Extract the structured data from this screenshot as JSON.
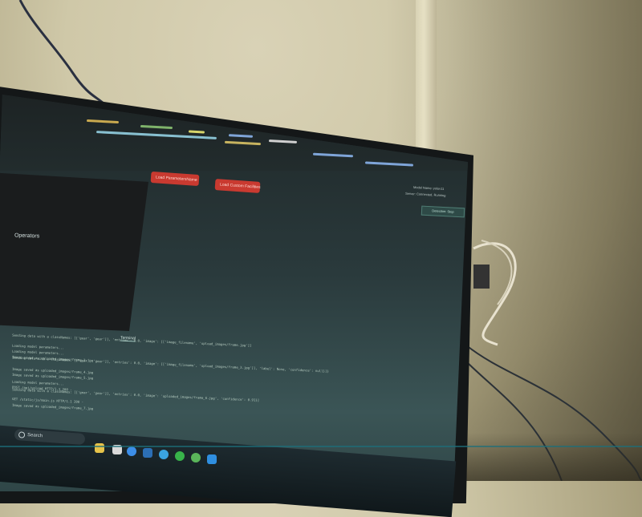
{
  "editor": {
    "button_1": "Load ParametersName",
    "button_2": "Load Custom Facilities",
    "status_line_1": "Model Name: yolov11",
    "status_line_2": "Server: Connected, Running",
    "status_button": "Detection: Stop"
  },
  "panel": {
    "label": "Operators"
  },
  "terminal": {
    "tab": "Terminal",
    "lines": [
      "Sending data with a classNames: [['gear', 'gear']], 'entries': 0.0, 'image': [['image_filename', 'upload_images/frame.jpg']]",
      "Loading model parameters...",
      "Loading model parameters...",
      "Image saved as uploaded_images/frame_2.jpg",
      "Sending data with a classNames: [['gear', 'gear']], 'entries': 0.0, 'image': [['image_filename', 'upload_images/frame_3.jpg']], 'label': None, 'confidence': null}]}",
      "Image saved as uploaded_images/frame_4.jpg",
      "Image saved as uploaded_images/frame_5.jpg",
      "Loading model parameters...",
      "POST /api/upload HTTP/1.1 200 -",
      "Sending data with a classNames: [['gear', 'gear']], 'entries': 0.0, 'image': 'uploaded_images/frame_6.jpg', 'confidence': 0.91}]",
      "GET /static/js/main.js HTTP/1.1 200 -",
      "Image saved as uploaded_images/frame_7.jpg"
    ]
  },
  "taskbar": {
    "search_placeholder": "Search"
  },
  "colors": {
    "button_red": "#c93a30",
    "screen_teal": "#3b5556",
    "wall": "#cfc8a8"
  }
}
